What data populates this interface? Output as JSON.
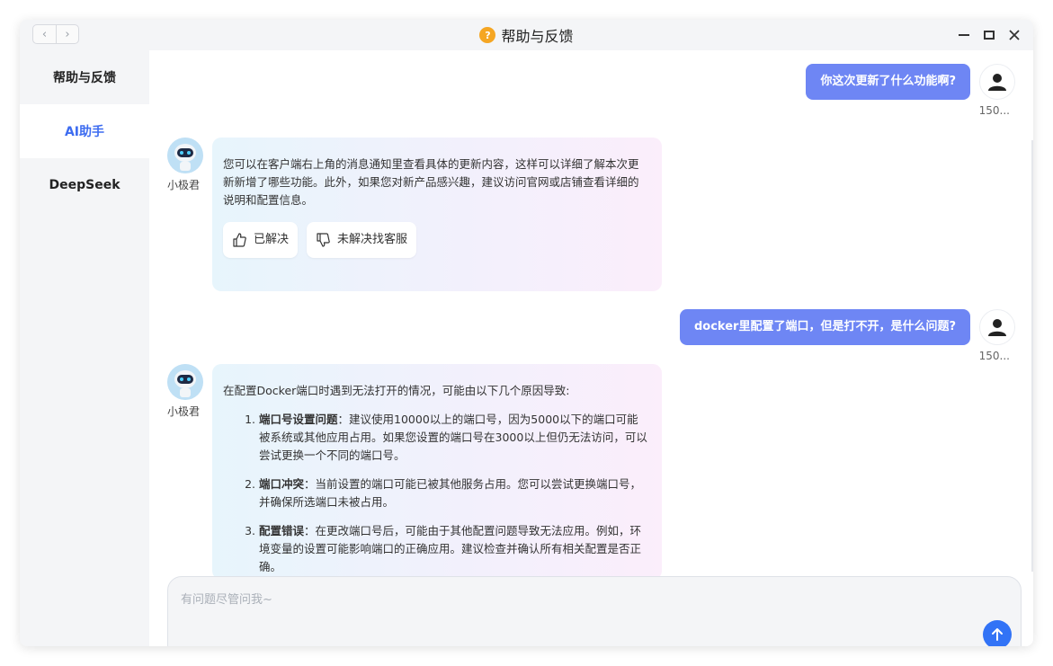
{
  "window": {
    "title": "帮助与反馈",
    "title_icon": "?",
    "nav_back_icon": "‹",
    "nav_forward_icon": "›"
  },
  "sidebar": {
    "items": [
      {
        "label": "帮助与反馈",
        "active": false
      },
      {
        "label": "AI助手",
        "active": true
      },
      {
        "label": "DeepSeek",
        "active": false
      }
    ]
  },
  "chat": {
    "messages": [
      {
        "role": "user",
        "text": "你这次更新了什么功能啊?",
        "name": "150..."
      },
      {
        "role": "bot",
        "name": "小极君",
        "text": "您可以在客户端右上角的消息通知里查看具体的更新内容，这样可以详细了解本次更新新增了哪些功能。此外，如果您对新产品感兴趣，建议访问官网或店铺查看详细的说明和配置信息。",
        "feedback": {
          "solved": "已解决",
          "unsolved": "未解决找客服"
        }
      },
      {
        "role": "user",
        "text": "docker里配置了端口，但是打不开，是什么问题?",
        "name": "150..."
      },
      {
        "role": "bot",
        "name": "小极君",
        "intro": "在配置Docker端口时遇到无法打开的情况，可能由以下几个原因导致:",
        "items": [
          {
            "title": "端口号设置问题",
            "sep": "：",
            "text": "建议使用10000以上的端口号，因为5000以下的端口可能被系统或其他应用占用。如果您设置的端口号在3000以上但仍无法访问，可以尝试更换一个不同的端口号。"
          },
          {
            "title": "端口冲突",
            "sep": "：",
            "text": "当前设置的端口可能已被其他服务占用。您可以尝试更换端口号，并确保所选端口未被占用。"
          },
          {
            "title": "配置错误",
            "sep": "：",
            "text": "在更改端口号后，可能由于其他配置问题导致无法应用。例如，环境变量的设置可能影响端口的正确应用。建议检查并确认所有相关配置是否正确。"
          }
        ]
      }
    ]
  },
  "input": {
    "placeholder": "有问题尽管问我~"
  },
  "colors": {
    "accent": "#3d6cf0",
    "user_bubble": "#6e86f4",
    "send_button": "#3273f6"
  }
}
